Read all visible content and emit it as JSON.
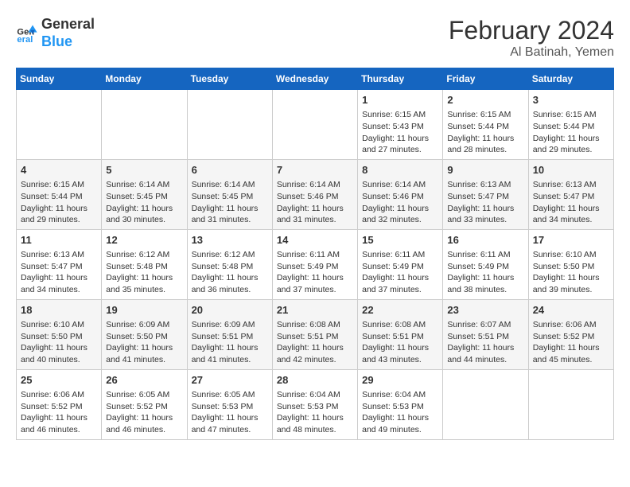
{
  "header": {
    "logo_line1": "General",
    "logo_line2": "Blue",
    "title": "February 2024",
    "subtitle": "Al Batinah, Yemen"
  },
  "weekdays": [
    "Sunday",
    "Monday",
    "Tuesday",
    "Wednesday",
    "Thursday",
    "Friday",
    "Saturday"
  ],
  "weeks": [
    [
      {
        "day": "",
        "info": ""
      },
      {
        "day": "",
        "info": ""
      },
      {
        "day": "",
        "info": ""
      },
      {
        "day": "",
        "info": ""
      },
      {
        "day": "1",
        "info": "Sunrise: 6:15 AM\nSunset: 5:43 PM\nDaylight: 11 hours and 27 minutes."
      },
      {
        "day": "2",
        "info": "Sunrise: 6:15 AM\nSunset: 5:44 PM\nDaylight: 11 hours and 28 minutes."
      },
      {
        "day": "3",
        "info": "Sunrise: 6:15 AM\nSunset: 5:44 PM\nDaylight: 11 hours and 29 minutes."
      }
    ],
    [
      {
        "day": "4",
        "info": "Sunrise: 6:15 AM\nSunset: 5:44 PM\nDaylight: 11 hours and 29 minutes."
      },
      {
        "day": "5",
        "info": "Sunrise: 6:14 AM\nSunset: 5:45 PM\nDaylight: 11 hours and 30 minutes."
      },
      {
        "day": "6",
        "info": "Sunrise: 6:14 AM\nSunset: 5:45 PM\nDaylight: 11 hours and 31 minutes."
      },
      {
        "day": "7",
        "info": "Sunrise: 6:14 AM\nSunset: 5:46 PM\nDaylight: 11 hours and 31 minutes."
      },
      {
        "day": "8",
        "info": "Sunrise: 6:14 AM\nSunset: 5:46 PM\nDaylight: 11 hours and 32 minutes."
      },
      {
        "day": "9",
        "info": "Sunrise: 6:13 AM\nSunset: 5:47 PM\nDaylight: 11 hours and 33 minutes."
      },
      {
        "day": "10",
        "info": "Sunrise: 6:13 AM\nSunset: 5:47 PM\nDaylight: 11 hours and 34 minutes."
      }
    ],
    [
      {
        "day": "11",
        "info": "Sunrise: 6:13 AM\nSunset: 5:47 PM\nDaylight: 11 hours and 34 minutes."
      },
      {
        "day": "12",
        "info": "Sunrise: 6:12 AM\nSunset: 5:48 PM\nDaylight: 11 hours and 35 minutes."
      },
      {
        "day": "13",
        "info": "Sunrise: 6:12 AM\nSunset: 5:48 PM\nDaylight: 11 hours and 36 minutes."
      },
      {
        "day": "14",
        "info": "Sunrise: 6:11 AM\nSunset: 5:49 PM\nDaylight: 11 hours and 37 minutes."
      },
      {
        "day": "15",
        "info": "Sunrise: 6:11 AM\nSunset: 5:49 PM\nDaylight: 11 hours and 37 minutes."
      },
      {
        "day": "16",
        "info": "Sunrise: 6:11 AM\nSunset: 5:49 PM\nDaylight: 11 hours and 38 minutes."
      },
      {
        "day": "17",
        "info": "Sunrise: 6:10 AM\nSunset: 5:50 PM\nDaylight: 11 hours and 39 minutes."
      }
    ],
    [
      {
        "day": "18",
        "info": "Sunrise: 6:10 AM\nSunset: 5:50 PM\nDaylight: 11 hours and 40 minutes."
      },
      {
        "day": "19",
        "info": "Sunrise: 6:09 AM\nSunset: 5:50 PM\nDaylight: 11 hours and 41 minutes."
      },
      {
        "day": "20",
        "info": "Sunrise: 6:09 AM\nSunset: 5:51 PM\nDaylight: 11 hours and 41 minutes."
      },
      {
        "day": "21",
        "info": "Sunrise: 6:08 AM\nSunset: 5:51 PM\nDaylight: 11 hours and 42 minutes."
      },
      {
        "day": "22",
        "info": "Sunrise: 6:08 AM\nSunset: 5:51 PM\nDaylight: 11 hours and 43 minutes."
      },
      {
        "day": "23",
        "info": "Sunrise: 6:07 AM\nSunset: 5:51 PM\nDaylight: 11 hours and 44 minutes."
      },
      {
        "day": "24",
        "info": "Sunrise: 6:06 AM\nSunset: 5:52 PM\nDaylight: 11 hours and 45 minutes."
      }
    ],
    [
      {
        "day": "25",
        "info": "Sunrise: 6:06 AM\nSunset: 5:52 PM\nDaylight: 11 hours and 46 minutes."
      },
      {
        "day": "26",
        "info": "Sunrise: 6:05 AM\nSunset: 5:52 PM\nDaylight: 11 hours and 46 minutes."
      },
      {
        "day": "27",
        "info": "Sunrise: 6:05 AM\nSunset: 5:53 PM\nDaylight: 11 hours and 47 minutes."
      },
      {
        "day": "28",
        "info": "Sunrise: 6:04 AM\nSunset: 5:53 PM\nDaylight: 11 hours and 48 minutes."
      },
      {
        "day": "29",
        "info": "Sunrise: 6:04 AM\nSunset: 5:53 PM\nDaylight: 11 hours and 49 minutes."
      },
      {
        "day": "",
        "info": ""
      },
      {
        "day": "",
        "info": ""
      }
    ]
  ]
}
